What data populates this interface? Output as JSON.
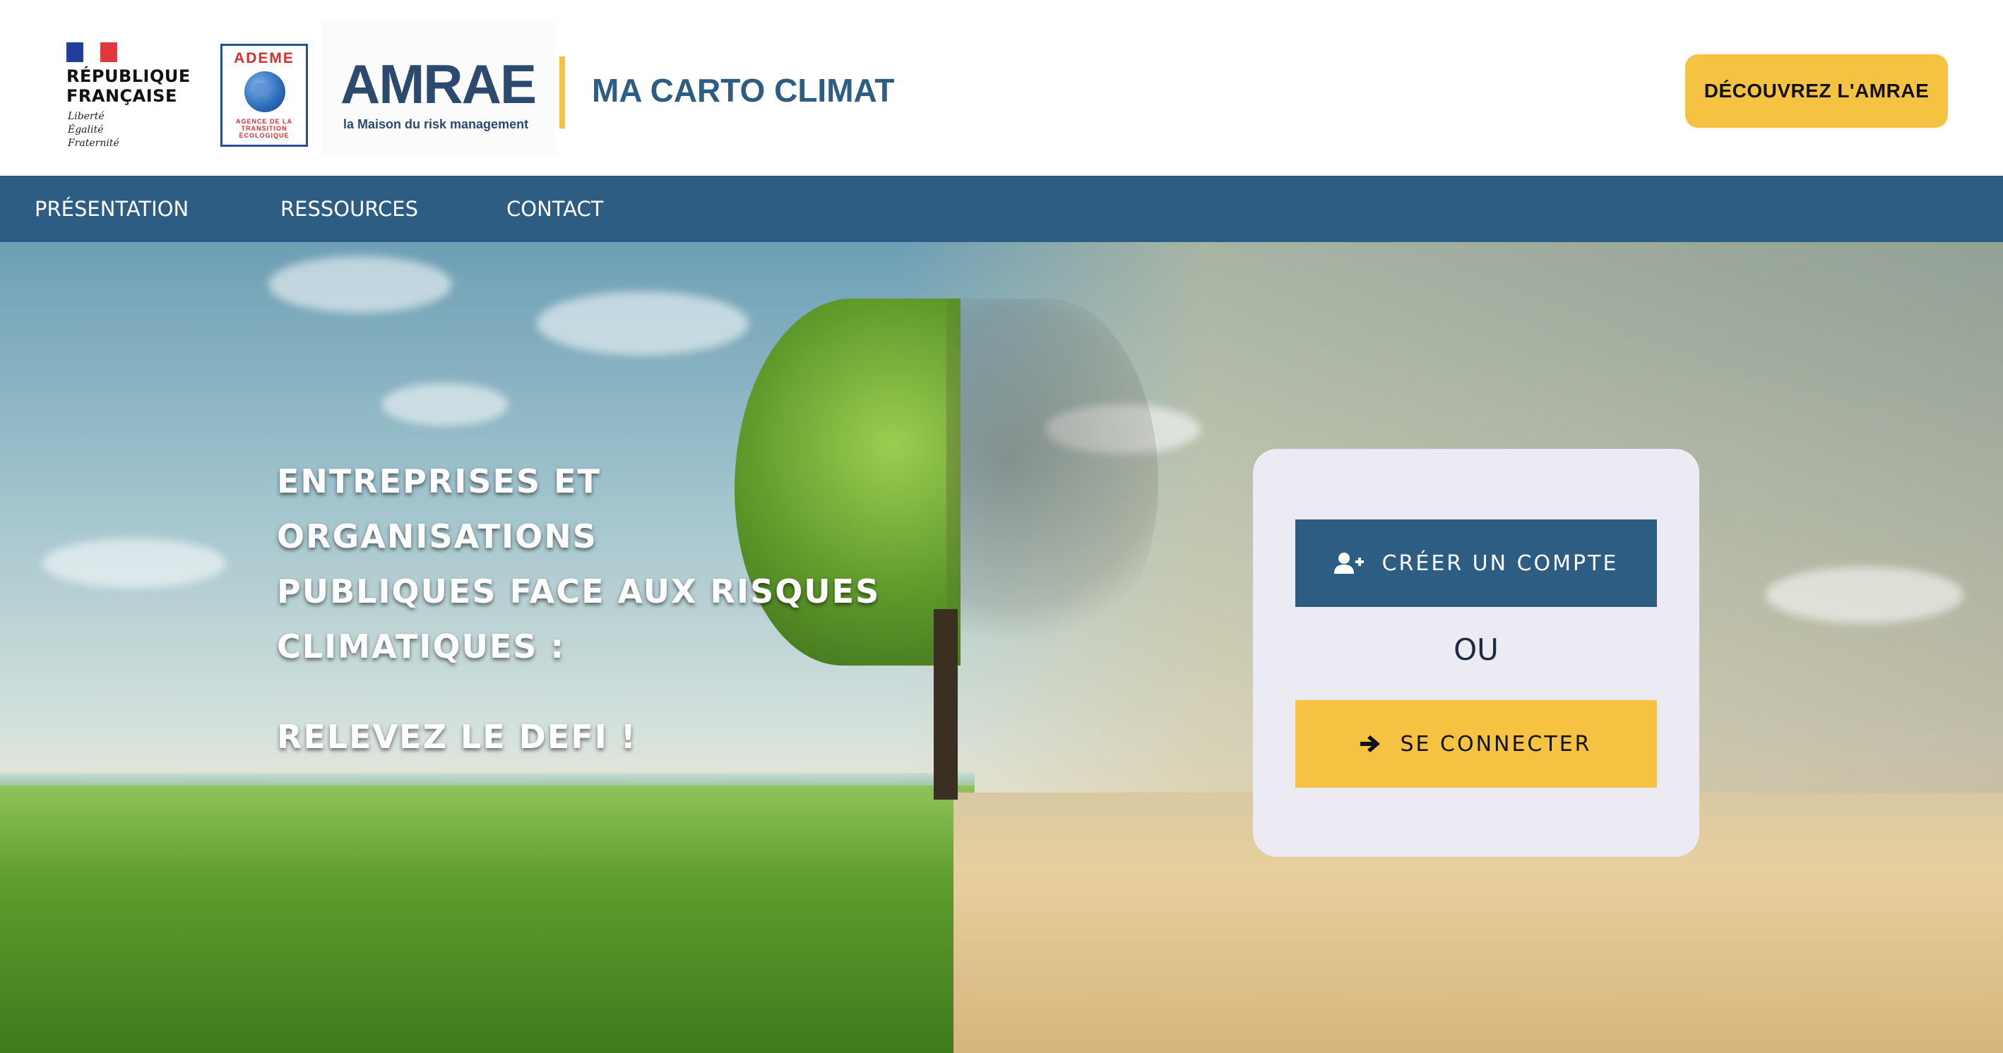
{
  "header": {
    "republique": {
      "title_line1": "RÉPUBLIQUE",
      "title_line2": "FRANÇAISE",
      "motto_line1": "Liberté",
      "motto_line2": "Égalité",
      "motto_line3": "Fraternité"
    },
    "ademe": {
      "name": "ADEME",
      "sub_line1": "AGENCE DE LA",
      "sub_line2": "TRANSITION",
      "sub_line3": "ÉCOLOGIQUE"
    },
    "amrae": {
      "name": "AMRAE",
      "tagline": "la Maison du risk management"
    },
    "brand": "MA CARTO CLIMAT",
    "cta_label": "DÉCOUVREZ L'AMRAE"
  },
  "nav": {
    "items": [
      {
        "label": "PRÉSENTATION"
      },
      {
        "label": "RESSOURCES"
      },
      {
        "label": "CONTACT"
      }
    ]
  },
  "hero": {
    "headline_line1": "ENTREPRISES ET ORGANISATIONS",
    "headline_line2": "PUBLIQUES FACE AUX RISQUES",
    "headline_line3": "CLIMATIQUES :",
    "headline_line4": "RELEVEZ LE DEFI !"
  },
  "login": {
    "create_label": "CRÉER UN COMPTE",
    "create_icon": "user-plus-icon",
    "or_label": "OU",
    "login_label": "SE CONNECTER",
    "login_icon": "arrow-right-icon"
  },
  "colors": {
    "primary": "#2d5d82",
    "accent": "#f5c242",
    "card_bg": "#eceaf3"
  }
}
